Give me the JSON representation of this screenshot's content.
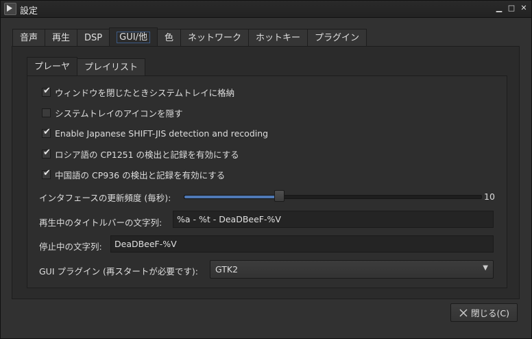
{
  "window": {
    "title": "設定",
    "controls": {
      "minimize": "▁",
      "maximize": "□",
      "close": "✕"
    }
  },
  "tabs": [
    {
      "label": "音声"
    },
    {
      "label": "再生"
    },
    {
      "label": "DSP"
    },
    {
      "label": "GUI/他",
      "active": true
    },
    {
      "label": "色"
    },
    {
      "label": "ネットワーク"
    },
    {
      "label": "ホットキー"
    },
    {
      "label": "プラグイン"
    }
  ],
  "subtabs": [
    {
      "label": "プレーヤ",
      "active": true
    },
    {
      "label": "プレイリスト"
    }
  ],
  "checkboxes": [
    {
      "label": "ウィンドウを閉じたときシステムトレイに格納",
      "checked": true
    },
    {
      "label": "システムトレイのアイコンを隠す",
      "checked": false
    },
    {
      "label": "Enable Japanese SHIFT-JIS detection and recoding",
      "checked": true
    },
    {
      "label": "ロシア語の CP1251 の検出と記録を有効にする",
      "checked": true
    },
    {
      "label": "中国語の CP936 の検出と記録を有効にする",
      "checked": true
    }
  ],
  "refresh": {
    "label": "インタフェースの更新頻度 (毎秒):",
    "value": "10",
    "fraction": 0.32
  },
  "playing_title": {
    "label": "再生中のタイトルバーの文字列:",
    "value": "%a - %t - DeaDBeeF-%V"
  },
  "stopped_title": {
    "label": "停止中の文字列:",
    "value": "DeaDBeeF-%V"
  },
  "gui_plugin": {
    "label": "GUI プラグイン (再スタートが必要です):",
    "value": "GTK2",
    "arrow": "▼"
  },
  "close_button": {
    "label": "閉じる(C)",
    "icon": "close-icon"
  },
  "colors": {
    "accent": "#4f79b5",
    "background": "#2e2e2e"
  }
}
